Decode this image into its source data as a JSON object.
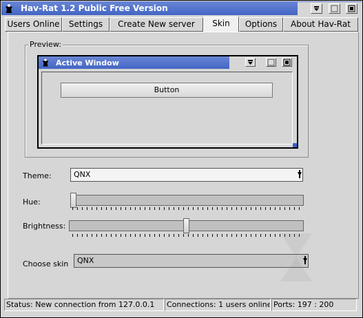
{
  "window": {
    "title": "Hav-Rat 1.2 Public Free Version"
  },
  "tabs": [
    {
      "label": "Users Online"
    },
    {
      "label": "Settings"
    },
    {
      "label": "Create New server"
    },
    {
      "label": "Skin",
      "active": true
    },
    {
      "label": "Options"
    },
    {
      "label": "About Hav-Rat"
    }
  ],
  "preview": {
    "group_label": "Preview:",
    "inner_title": "Active Window",
    "inner_button": "Button"
  },
  "theme": {
    "label": "Theme:",
    "value": "QNX"
  },
  "hue": {
    "label": "Hue:",
    "level": 0.0
  },
  "brightness": {
    "label": "Brightness:",
    "level": 0.5
  },
  "skin": {
    "label": "Choose skin",
    "value": "QNX"
  },
  "status": {
    "message": "Status: New connection from 127.0.0.1",
    "connections": "Connections: 1 users online",
    "ports": "Ports: 197 : 200"
  },
  "colors": {
    "titlebar": "#4a6fc9",
    "face": "#d6d6d6"
  }
}
